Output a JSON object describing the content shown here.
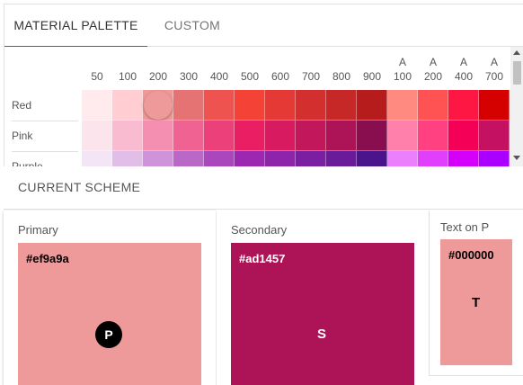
{
  "tabs": [
    {
      "label": "MATERIAL PALETTE",
      "active": true
    },
    {
      "label": "CUSTOM",
      "active": false
    }
  ],
  "palette": {
    "columns": [
      {
        "a": "",
        "n": "50"
      },
      {
        "a": "",
        "n": "100"
      },
      {
        "a": "",
        "n": "200"
      },
      {
        "a": "",
        "n": "300"
      },
      {
        "a": "",
        "n": "400"
      },
      {
        "a": "",
        "n": "500"
      },
      {
        "a": "",
        "n": "600"
      },
      {
        "a": "",
        "n": "700"
      },
      {
        "a": "",
        "n": "800"
      },
      {
        "a": "",
        "n": "900"
      },
      {
        "a": "A",
        "n": "100"
      },
      {
        "a": "A",
        "n": "200"
      },
      {
        "a": "A",
        "n": "400"
      },
      {
        "a": "A",
        "n": "700"
      }
    ],
    "rows": [
      {
        "name": "Red",
        "colors": [
          "#ffebee",
          "#ffcdd2",
          "#ef9a9a",
          "#e57373",
          "#ef5350",
          "#f44336",
          "#e53935",
          "#d32f2f",
          "#c62828",
          "#b71c1c",
          "#ff8a80",
          "#ff5252",
          "#ff1744",
          "#d50000"
        ],
        "selected_index": 2
      },
      {
        "name": "Pink",
        "colors": [
          "#fce4ec",
          "#f8bbd0",
          "#f48fb1",
          "#f06292",
          "#ec407a",
          "#e91e63",
          "#d81b60",
          "#c2185b",
          "#ad1457",
          "#880e4f",
          "#ff80ab",
          "#ff4081",
          "#f50057",
          "#c51162"
        ],
        "selected_index": -1
      },
      {
        "name": "Purple",
        "colors": [
          "#f3e5f5",
          "#e1bee7",
          "#ce93d8",
          "#ba68c8",
          "#ab47bc",
          "#9c27b0",
          "#8e24aa",
          "#7b1fa2",
          "#6a1b9a",
          "#4a148c",
          "#ea80fc",
          "#e040fb",
          "#d500f9",
          "#aa00ff"
        ],
        "selected_index": -1
      }
    ]
  },
  "scheme": {
    "title": "CURRENT SCHEME",
    "primary": {
      "label": "Primary",
      "hex": "#ef9a9a",
      "color": "#ef9a9a",
      "text_color": "#000000",
      "badge": "P"
    },
    "secondary": {
      "label": "Secondary",
      "hex": "#ad1457",
      "color": "#ad1457",
      "text_color": "#ffffff",
      "letter": "S"
    },
    "text_on_primary": {
      "label": "Text on P",
      "hex": "#000000",
      "color": "#ef9a9a",
      "text_color": "#000000",
      "letter": "T"
    }
  }
}
